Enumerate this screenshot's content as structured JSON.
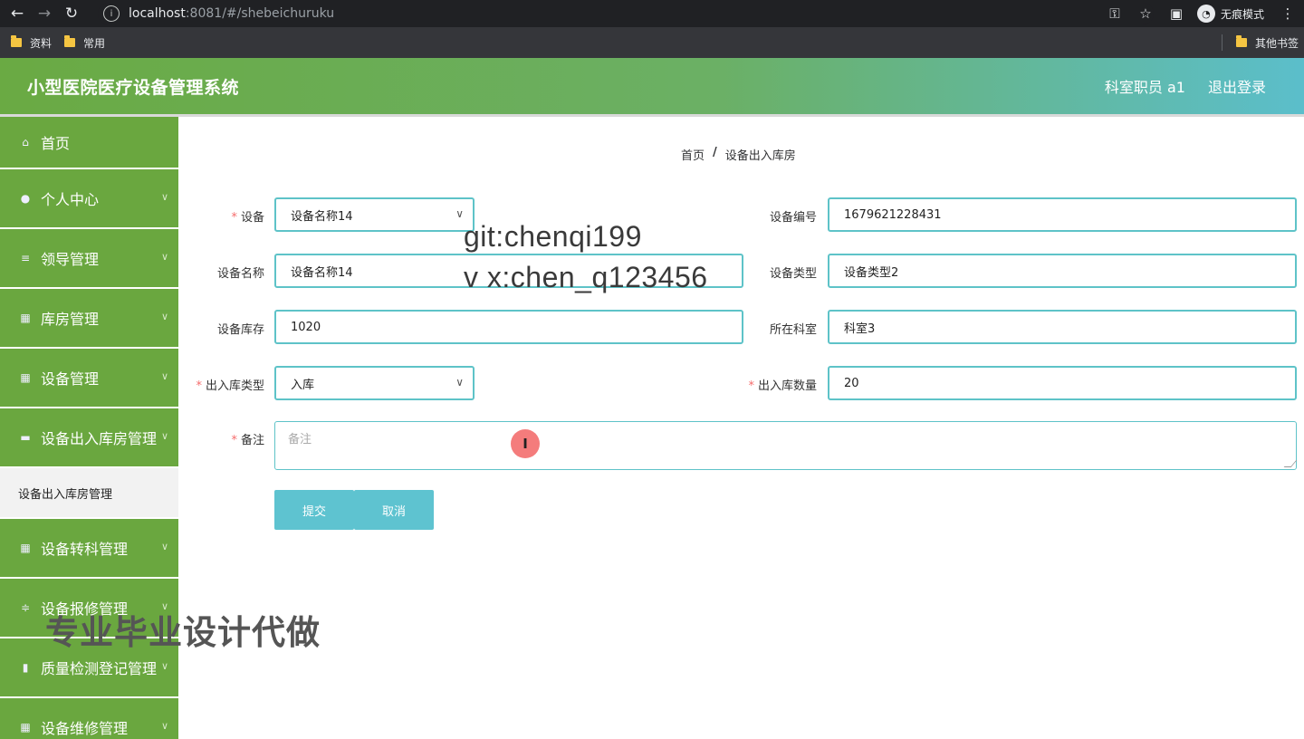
{
  "browser": {
    "url_host": "localhost",
    "url_rest": ":8081/#/shebeichuruku",
    "incognito_label": "无痕模式",
    "bookmarks": [
      "资料",
      "常用"
    ],
    "other_bookmarks": "其他书签"
  },
  "header": {
    "title": "小型医院医疗设备管理系统",
    "user": "科室职员 a1",
    "logout": "退出登录"
  },
  "sidebar": {
    "items": [
      {
        "label": "首页",
        "icon": "home-icon"
      },
      {
        "label": "个人中心",
        "icon": "user-icon"
      },
      {
        "label": "领导管理",
        "icon": "list-icon"
      },
      {
        "label": "库房管理",
        "icon": "grid-icon"
      },
      {
        "label": "设备管理",
        "icon": "apps-icon"
      },
      {
        "label": "设备出入库房管理",
        "icon": "cabinet-icon"
      },
      {
        "label": "设备转科管理",
        "icon": "apps-icon"
      },
      {
        "label": "设备报修管理",
        "icon": "sliders-icon"
      },
      {
        "label": "质量检测登记管理",
        "icon": "bar-chart-icon"
      },
      {
        "label": "设备维修管理",
        "icon": "apps-icon"
      }
    ],
    "submenu_active": "设备出入库房管理"
  },
  "breadcrumb": {
    "home": "首页",
    "separator": "/",
    "current": "设备出入库房"
  },
  "form": {
    "device_label": "设备",
    "device_value": "设备名称14",
    "device_code_label": "设备编号",
    "device_code_value": "1679621228431",
    "device_name_label": "设备名称",
    "device_name_value": "设备名称14",
    "device_type_label": "设备类型",
    "device_type_value": "设备类型2",
    "stock_label": "设备库存",
    "stock_value": "1020",
    "dept_label": "所在科室",
    "dept_value": "科室3",
    "io_type_label": "出入库类型",
    "io_type_value": "入库",
    "io_qty_label": "出入库数量",
    "io_qty_value": "20",
    "remark_label": "备注",
    "remark_placeholder": "备注",
    "submit": "提交",
    "cancel": "取消"
  },
  "overlay": {
    "git": "git:chenqi199",
    "vx": "v x:chen_q123456",
    "ad": "专业毕业设计代做"
  }
}
